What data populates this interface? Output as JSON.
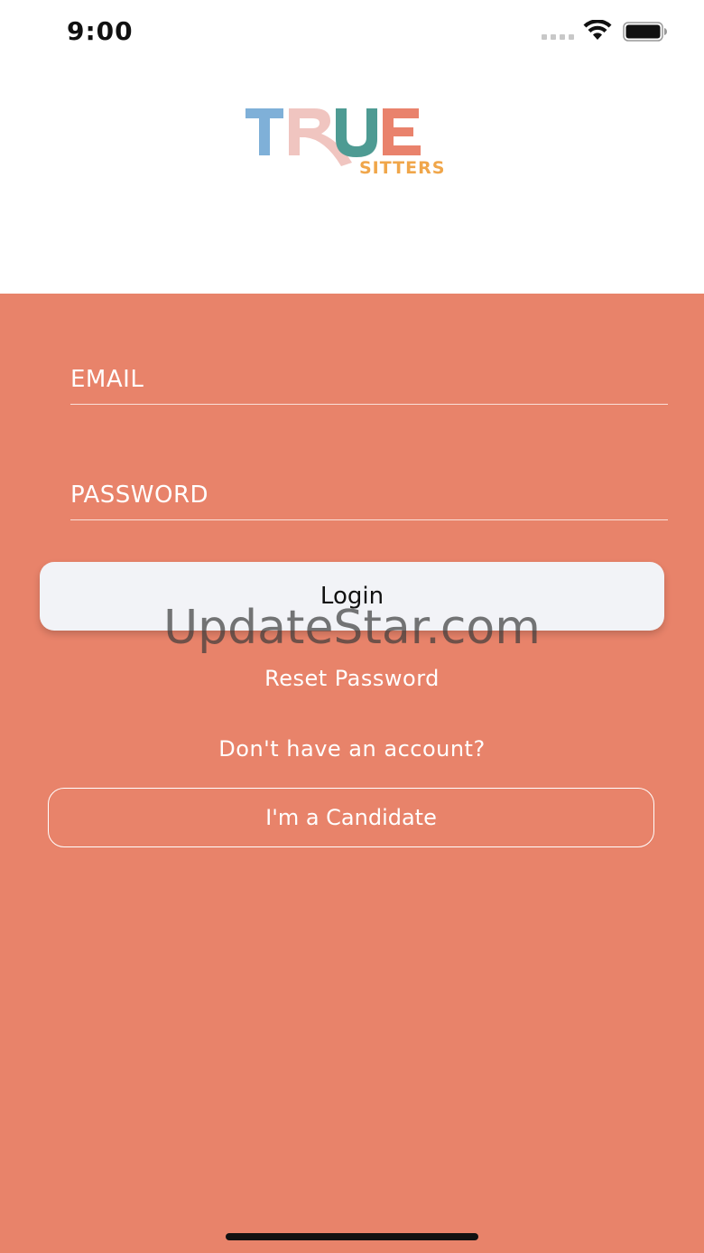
{
  "status_bar": {
    "time": "9:00"
  },
  "logo": {
    "word_true": "TRUE",
    "word_sitters": "SITTERS",
    "colors": {
      "T": "#7fb0d8",
      "R": "#f0c5c0",
      "U": "#4e9b93",
      "E": "#e9826c",
      "sitters": "#f0a64a"
    }
  },
  "form": {
    "email_placeholder": "EMAIL",
    "password_placeholder": "PASSWORD",
    "login_label": "Login",
    "reset_password_label": "Reset Password",
    "no_account_text": "Don't have an account?",
    "candidate_label": "I'm a Candidate"
  },
  "watermark": "UpdateStar.com",
  "colors": {
    "background_accent": "#e8836a",
    "login_button_bg": "#f2f3f7"
  }
}
